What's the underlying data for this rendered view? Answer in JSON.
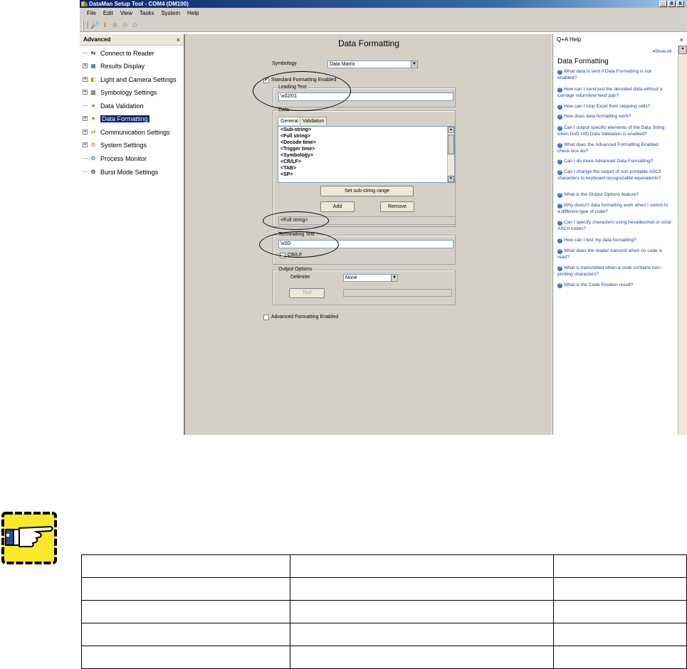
{
  "window": {
    "title": "DataMan Setup Tool - COM4 (DM100)",
    "controls": [
      "_",
      "8",
      "X"
    ]
  },
  "menu": [
    "File",
    "Edit",
    "View",
    "Tasks",
    "System",
    "Help"
  ],
  "left_panel": {
    "header": "Advanced",
    "close": "×",
    "items": [
      {
        "label": "Connect to Reader",
        "expandable": false,
        "icon": "connect-icon"
      },
      {
        "label": "Results Display",
        "expandable": true,
        "icon": "results-icon"
      },
      {
        "label": "Light and Camera Settings",
        "expandable": true,
        "icon": "camera-icon"
      },
      {
        "label": "Symbology Settings",
        "expandable": true,
        "icon": "symbology-icon"
      },
      {
        "label": "Data Validation",
        "expandable": false,
        "icon": "validation-icon"
      },
      {
        "label": "Data Formatting",
        "expandable": true,
        "icon": "formatting-icon",
        "selected": true
      },
      {
        "label": "Communication Settings",
        "expandable": true,
        "icon": "communication-icon"
      },
      {
        "label": "System Settings",
        "expandable": true,
        "icon": "system-icon"
      },
      {
        "label": "Process Monitor",
        "expandable": false,
        "icon": "monitor-icon"
      },
      {
        "label": "Burst Mode Settings",
        "expandable": false,
        "icon": "burst-icon"
      }
    ]
  },
  "main": {
    "title": "Data Formatting",
    "symbology_label": "Symbology",
    "symbology_value": "Data Matrix",
    "standard_formatting_label": "Standard Formatting Enabled",
    "standard_formatting_checked": true,
    "leading_text_label": "Leading Text",
    "leading_text_value": "\\x02/01",
    "data_group_label": "Data",
    "tabs": [
      "General",
      "Validation"
    ],
    "data_list": [
      "<Sub-string>",
      "<Full string>",
      "<Decode time>",
      "<Trigger time>",
      "<Symbology>",
      "<CR/LF>",
      "<TAB>",
      "<SP>"
    ],
    "set_substring_button": "Set sub-string range",
    "add_button": "Add",
    "remove_button": "Remove",
    "data_result": "<Full string>",
    "terminating_text_label": "Terminating Text",
    "terminating_text_value": "\\x0D",
    "crlf_label": "CR/LF",
    "output_options_label": "Output Options",
    "delimiter_label": "Delimiter",
    "delimiter_value": "None",
    "test_button": "Test",
    "advanced_formatting_label": "Advanced Formatting Enabled"
  },
  "help": {
    "header": "Q+A Help",
    "close": "×",
    "show_all": "Show All",
    "title": "Data Formatting",
    "links": [
      "What data is sent if Data Formatting is not enabled?",
      "How can I send just the decoded data without a carriage return/line feed pair?",
      "How can I stop Excel from skipping cells?",
      "How does data formatting work?",
      "Can I output specific elements of the Data String when DoD UID Data Validation is enabled?",
      "What does the Advanced Formatting Enabled check-box do?",
      "Can I do more Advanced Data Formatting?",
      "Can I change the output of non-printable ASCII characters to keyboard recognizable equivalents?",
      "What is the Output Options feature?",
      "Why doesn't data formatting work when I switch to a different type of code?",
      "Can I specify characters using hexadecimal or octal ASCII codes?",
      "How can I test my data formatting?",
      "What does the reader transmit when no code is read?",
      "What is transmitted when a code contains non-printing characters?",
      "What is the Code Position result?"
    ]
  },
  "doc": {
    "pointer_icon": "pointing-hand-icon",
    "table_rows": 5,
    "table_cols": 3
  }
}
